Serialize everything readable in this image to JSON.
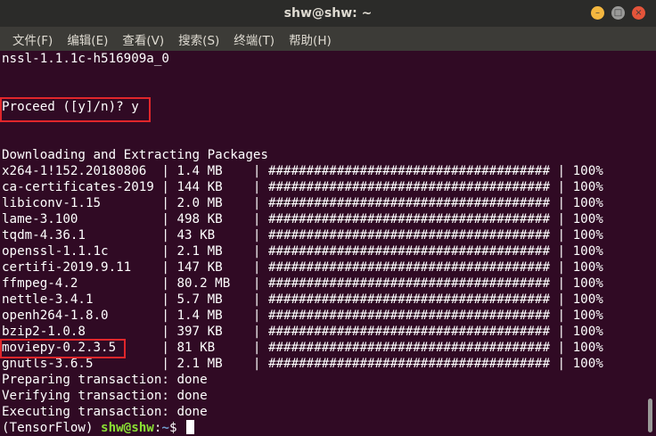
{
  "window": {
    "title": "shw@shw: ~",
    "controls": {
      "minimize": "–",
      "maximize": "□",
      "close": "×"
    }
  },
  "menu": [
    "文件(F)",
    "编辑(E)",
    "查看(V)",
    "搜索(S)",
    "终端(T)",
    "帮助(H)"
  ],
  "terminal": {
    "lines": [
      "nssl-1.1.1c-h516909a_0",
      "",
      "",
      "Proceed ([y]/n)? y",
      "",
      "",
      "Downloading and Extracting Packages",
      "x264-1!152.20180806  | 1.4 MB    | ##################################### | 100%",
      "ca-certificates-2019 | 144 KB    | ##################################### | 100%",
      "libiconv-1.15        | 2.0 MB    | ##################################### | 100%",
      "lame-3.100           | 498 KB    | ##################################### | 100%",
      "tqdm-4.36.1          | 43 KB     | ##################################### | 100%",
      "openssl-1.1.1c       | 2.1 MB    | ##################################### | 100%",
      "certifi-2019.9.11    | 147 KB    | ##################################### | 100%",
      "ffmpeg-4.2           | 80.2 MB   | ##################################### | 100%",
      "nettle-3.4.1         | 5.7 MB    | ##################################### | 100%",
      "openh264-1.8.0       | 1.4 MB    | ##################################### | 100%",
      "bzip2-1.0.8          | 397 KB    | ##################################### | 100%",
      "moviepy-0.2.3.5      | 81 KB     | ##################################### | 100%",
      "gnutls-3.6.5         | 2.1 MB    | ##################################### | 100%",
      "Preparing transaction: done",
      "Verifying transaction: done",
      "Executing transaction: done"
    ],
    "prompt": {
      "env": "(TensorFlow) ",
      "user": "shw@shw",
      "sep": ":",
      "path": "~",
      "symbol": "$ "
    }
  },
  "colors": {
    "background": "#300a24",
    "highlight": "#e0262b",
    "prompt_user": "#8ae234",
    "prompt_path": "#729fcf"
  }
}
